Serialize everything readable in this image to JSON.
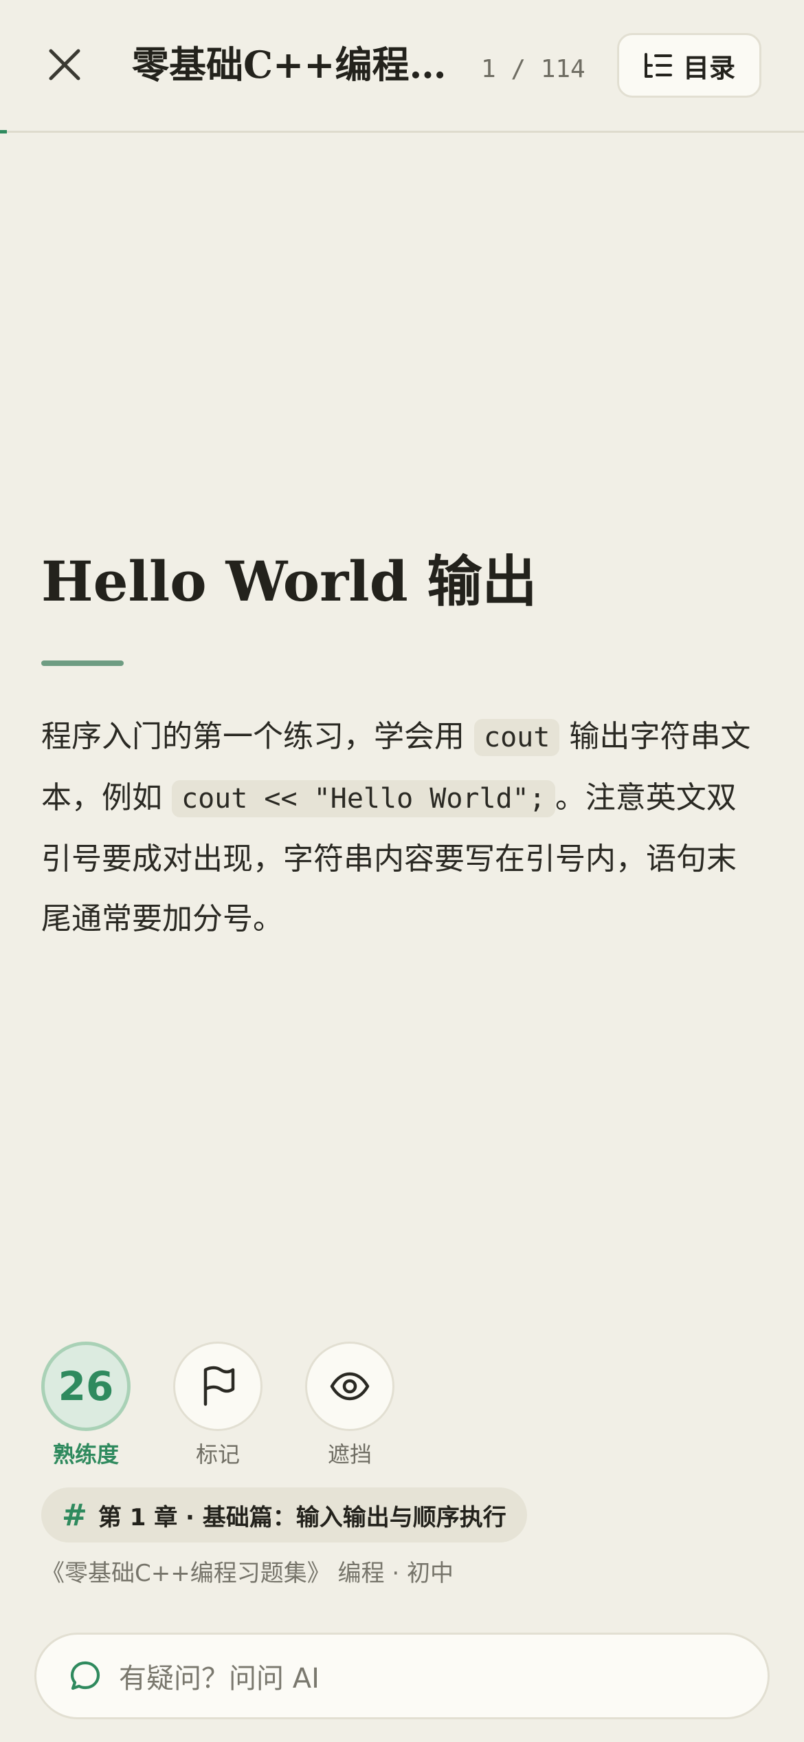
{
  "header": {
    "title": "零基础C++编程习题集",
    "page_counter": "1 / 114",
    "toc_label": "目录",
    "progress_fraction": 0.0088
  },
  "card": {
    "title": "Hello World 输出",
    "body": {
      "part1": "程序入门的第一个练习，学会用 ",
      "code1": "cout",
      "part2": " 输出字符串文本，例如 ",
      "code2": "cout << \"Hello World\";",
      "part3": "。注意英文双引号要成对出现，字符串内容要写在引号内，语句末尾通常要加分号。"
    }
  },
  "actions": {
    "mastery_value": "26",
    "mastery_label": "熟练度",
    "mark_label": "标记",
    "hide_label": "遮挡"
  },
  "meta": {
    "chapter": "第 1 章 · 基础篇：输入输出与顺序执行",
    "source": "《零基础C++编程习题集》 编程 · 初中"
  },
  "ask": {
    "placeholder": "有疑问？问问 AI"
  },
  "colors": {
    "accent": "#2f8a5e",
    "background": "#f1efe6"
  }
}
